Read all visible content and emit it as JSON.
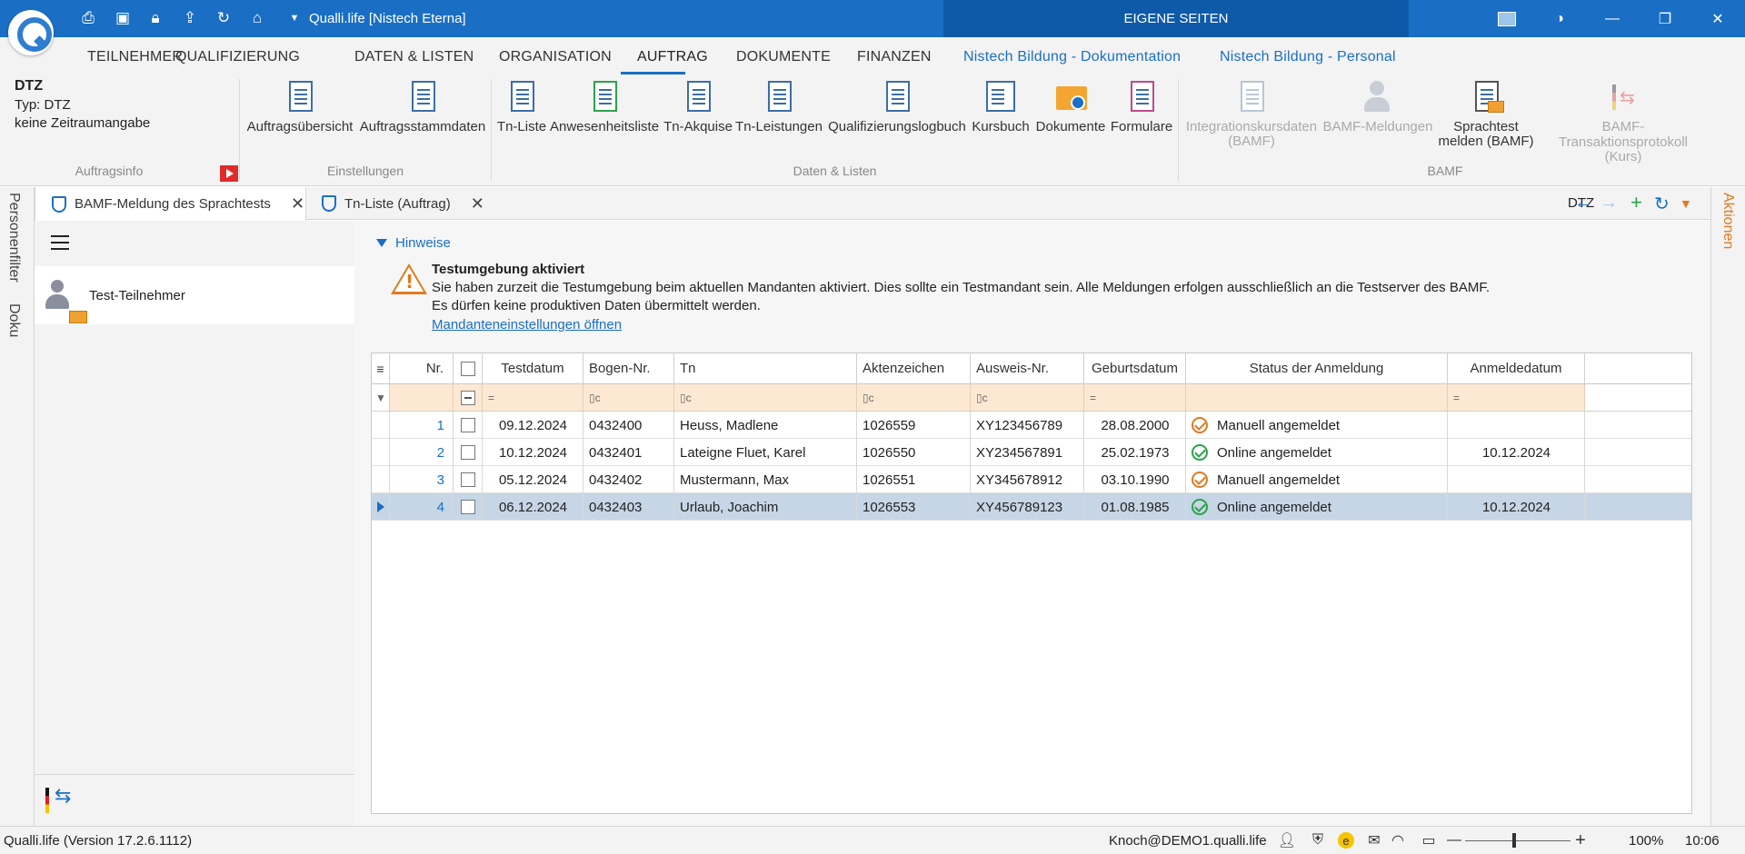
{
  "titlebar": {
    "title": "Qualli.life [Nistech Eterna]",
    "eigene_seiten": "EIGENE SEITEN",
    "icons": [
      "print-icon",
      "save-icon",
      "lock-icon",
      "export-icon",
      "refresh-icon",
      "home-icon",
      "dropdown-icon"
    ]
  },
  "menu": {
    "tabs": [
      "TEILNEHMER",
      "QUALIFIZIERUNG",
      "DATEN & LISTEN",
      "ORGANISATION",
      "AUFTRAG",
      "DOKUMENTE",
      "FINANZEN",
      "Nistech Bildung - Dokumentation",
      "Nistech Bildung - Personal"
    ],
    "active": "AUFTRAG"
  },
  "ribbon": {
    "info": {
      "title": "DTZ",
      "type": "Typ: DTZ",
      "period": "keine Zeitraumangabe",
      "group": "Auftragsinfo"
    },
    "einstellungen": {
      "group": "Einstellungen",
      "buttons": [
        "Auftragsübersicht",
        "Auftragsstammdaten"
      ]
    },
    "daten": {
      "group": "Daten & Listen",
      "buttons": [
        "Tn-Liste",
        "Anwesenheitsliste",
        "Tn-Akquise",
        "Tn-Leistungen",
        "Qualifizierungslogbuch",
        "Kursbuch",
        "Dokumente",
        "Formulare"
      ]
    },
    "bamf": {
      "group": "BAMF",
      "integration_line1": "Integrationskursdaten",
      "integration_line2": "(BAMF)",
      "meldungen": "BAMF-Meldungen",
      "sprachtest_line1": "Sprachtest",
      "sprachtest_line2": "melden (BAMF)",
      "protokoll_line1": "BAMF-Transaktionsprotokoll",
      "protokoll_line2": "(Kurs)"
    }
  },
  "left_strip": {
    "personenfilter": "Personenfilter",
    "doku": "Doku"
  },
  "right_strip": {
    "aktionen": "Aktionen"
  },
  "doctabs": {
    "tabs": [
      {
        "label": "BAMF-Meldung des Sprachtests",
        "close": "✕"
      },
      {
        "label": "Tn-Liste (Auftrag)",
        "close": "✕"
      }
    ],
    "context": "DTZ"
  },
  "sidebar": {
    "item": "Test-Teilnehmer"
  },
  "hinweise": {
    "label": "Hinweise",
    "title": "Testumgebung aktiviert",
    "line1": "Sie haben zurzeit die Testumgebung beim aktuellen Mandanten aktiviert. Dies sollte ein Testmandant sein. Alle Meldungen erfolgen ausschließlich an die Testserver des BAMF.",
    "line2": "Es dürfen keine produktiven Daten übermittelt werden.",
    "link": "Mandanteneinstellungen öffnen"
  },
  "grid": {
    "columns": [
      "Nr.",
      "Testdatum",
      "Bogen-Nr.",
      "Tn",
      "Aktenzeichen",
      "Ausweis-Nr.",
      "Geburtsdatum",
      "Status der Anmeldung",
      "Anmeldedatum"
    ],
    "filter_symbols": {
      "eq": "=",
      "contains": "▯c"
    },
    "rows": [
      {
        "nr": "1",
        "testdatum": "09.12.2024",
        "bogen": "0432400",
        "tn": "Heuss, Madlene",
        "akten": "1026559",
        "ausweis": "XY123456789",
        "geburt": "28.08.2000",
        "status": "Manuell angemeldet",
        "status_color": "#e07a1f",
        "anmelde": ""
      },
      {
        "nr": "2",
        "testdatum": "10.12.2024",
        "bogen": "0432401",
        "tn": "Lateigne Fluet, Karel",
        "akten": "1026550",
        "ausweis": "XY234567891",
        "geburt": "25.02.1973",
        "status": "Online angemeldet",
        "status_color": "#2aa34a",
        "anmelde": "10.12.2024"
      },
      {
        "nr": "3",
        "testdatum": "05.12.2024",
        "bogen": "0432402",
        "tn": "Mustermann, Max",
        "akten": "1026551",
        "ausweis": "XY345678912",
        "geburt": "03.10.1990",
        "status": "Manuell angemeldet",
        "status_color": "#e07a1f",
        "anmelde": ""
      },
      {
        "nr": "4",
        "testdatum": "06.12.2024",
        "bogen": "0432403",
        "tn": "Urlaub, Joachim",
        "akten": "1026553",
        "ausweis": "XY456789123",
        "geburt": "01.08.1985",
        "status": "Online angemeldet",
        "status_color": "#2aa34a",
        "anmelde": "10.12.2024"
      }
    ]
  },
  "statusbar": {
    "version": "Qualli.life (Version 17.2.6.1112)",
    "user": "Knoch@DEMO1.qualli.life",
    "zoom": "100%",
    "time": "10:06"
  }
}
